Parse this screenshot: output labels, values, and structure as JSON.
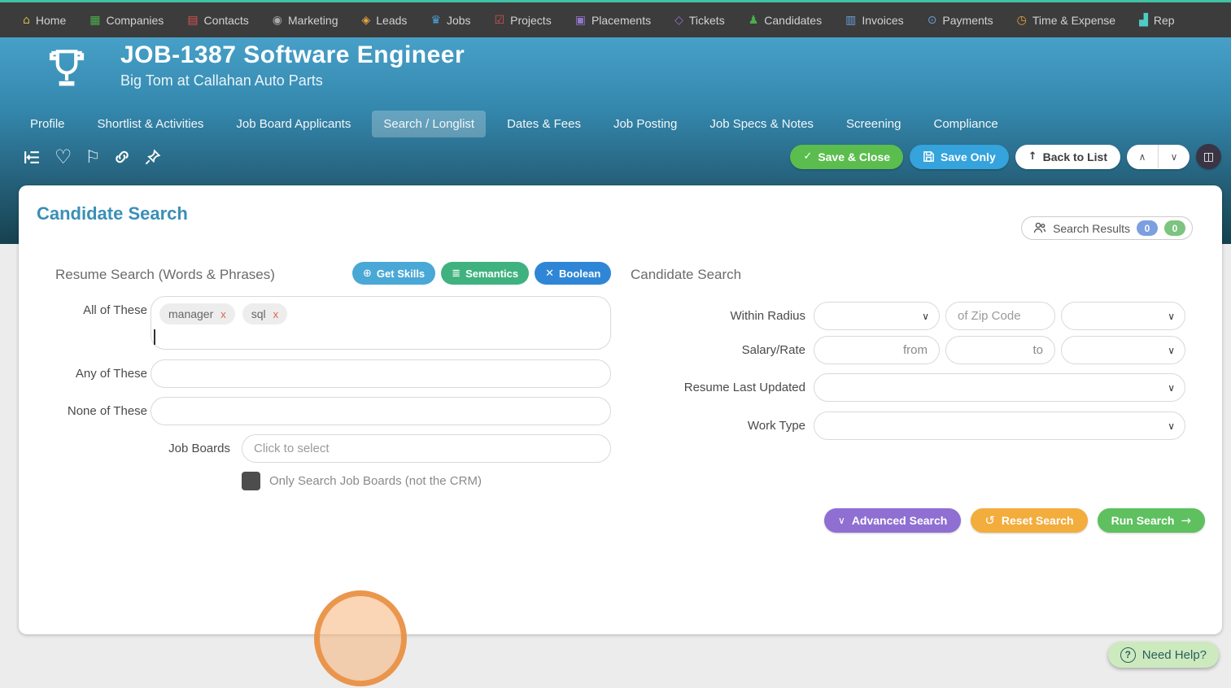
{
  "nav": {
    "items": [
      {
        "label": "Home",
        "icon": "home-icon",
        "glyph": "⌂",
        "icon_style": "color:#cdb24a"
      },
      {
        "label": "Companies",
        "icon": "companies-icon",
        "glyph": "▦",
        "icon_style": "color:#4cae4c"
      },
      {
        "label": "Contacts",
        "icon": "contacts-icon",
        "glyph": "▤",
        "icon_style": "color:#d9534f"
      },
      {
        "label": "Marketing",
        "icon": "marketing-icon",
        "glyph": "◉",
        "icon_style": "color:#a9a9a9"
      },
      {
        "label": "Leads",
        "icon": "leads-icon",
        "glyph": "◈",
        "icon_style": "color:#e8a33d"
      },
      {
        "label": "Jobs",
        "icon": "jobs-icon",
        "glyph": "♛",
        "icon_style": "color:#4aa3d8"
      },
      {
        "label": "Projects",
        "icon": "projects-icon",
        "glyph": "☑",
        "icon_style": "color:#d9534f"
      },
      {
        "label": "Placements",
        "icon": "placements-icon",
        "glyph": "▣",
        "icon_style": "color:#9575cd"
      },
      {
        "label": "Tickets",
        "icon": "tickets-icon",
        "glyph": "◇",
        "icon_style": "color:#9575cd"
      },
      {
        "label": "Candidates",
        "icon": "candidates-icon",
        "glyph": "♟",
        "icon_style": "color:#4cae4c"
      },
      {
        "label": "Invoices",
        "icon": "invoices-icon",
        "glyph": "▥",
        "icon_style": "color:#6a9fd8"
      },
      {
        "label": "Payments",
        "icon": "payments-icon",
        "glyph": "⊙",
        "icon_style": "color:#6a9fd8"
      },
      {
        "label": "Time & Expense",
        "icon": "time-expense-icon",
        "glyph": "◷",
        "icon_style": "color:#e8a33d"
      },
      {
        "label": "Rep",
        "icon": "reports-icon",
        "glyph": "▟",
        "icon_style": "color:#4ecdc4"
      }
    ]
  },
  "header": {
    "job_title": "JOB-1387 Software Engineer",
    "subtitle": "Big Tom at Callahan Auto Parts"
  },
  "tabs": {
    "items": [
      {
        "label": "Profile"
      },
      {
        "label": "Shortlist & Activities"
      },
      {
        "label": "Job Board Applicants"
      },
      {
        "label": "Search / Longlist"
      },
      {
        "label": "Dates & Fees"
      },
      {
        "label": "Job Posting"
      },
      {
        "label": "Job Specs & Notes"
      },
      {
        "label": "Screening"
      },
      {
        "label": "Compliance"
      }
    ],
    "selected": "Search / Longlist"
  },
  "toolbar": {
    "save_close_label": "Save & Close",
    "save_only_label": "Save Only",
    "back_to_list_label": "Back to List",
    "check_glyph": "✓",
    "up_arrow_glyph": "↑",
    "chevron_up_glyph": "∧",
    "chevron_down_glyph": "∨",
    "panel_glyph": "◫"
  },
  "search_panel": {
    "title": "Candidate Search",
    "results": {
      "label": "Search Results",
      "count_blue": "0",
      "count_green": "0"
    },
    "resume_section": {
      "heading": "Resume Search (Words & Phrases)",
      "get_skills_label": "Get Skills",
      "get_skills_glyph": "⊕",
      "semantics_label": "Semantics",
      "semantics_glyph": "≣",
      "boolean_label": "Boolean",
      "boolean_glyph": "✕",
      "all_of_these_label": "All of These",
      "tags": [
        {
          "text": "manager",
          "remove": "x"
        },
        {
          "text": "sql",
          "remove": "x"
        }
      ],
      "any_of_these_label": "Any of These",
      "none_of_these_label": "None of These",
      "job_boards_label": "Job Boards",
      "job_boards_placeholder": "Click to select",
      "checkbox_label": "Only Search Job Boards (not the CRM)"
    },
    "candidate_section": {
      "heading": "Candidate Search",
      "within_radius_label": "Within Radius",
      "zip_placeholder": "of Zip Code",
      "salary_label": "Salary/Rate",
      "from_placeholder": "from",
      "to_placeholder": "to",
      "resume_updated_label": "Resume Last Updated",
      "work_type_label": "Work Type",
      "select_chevron_glyph": "∨"
    },
    "actions": {
      "advanced_label": "Advanced Search",
      "advanced_glyph": "∨",
      "reset_label": "Reset Search",
      "reset_glyph": "↺",
      "run_label": "Run Search",
      "run_glyph": "→"
    }
  },
  "help": {
    "label": "Need Help?",
    "glyph": "?"
  },
  "colors": {
    "topbar_accent": "#3fc3a4",
    "header_blue": "#47a0c8",
    "save_close_green": "#5bbd4e",
    "save_only_blue": "#35a3dc",
    "get_skills_blue": "#49a8d6",
    "semantics_green": "#3fb27f",
    "boolean_blue": "#2f86d6",
    "advanced_purple": "#8f6fd2",
    "reset_orange": "#f3ad3d",
    "run_green": "#5ec05e",
    "badge_blue": "#7b9fe0",
    "badge_green": "#7cc47f",
    "highlight_orange": "#e78c3b"
  }
}
